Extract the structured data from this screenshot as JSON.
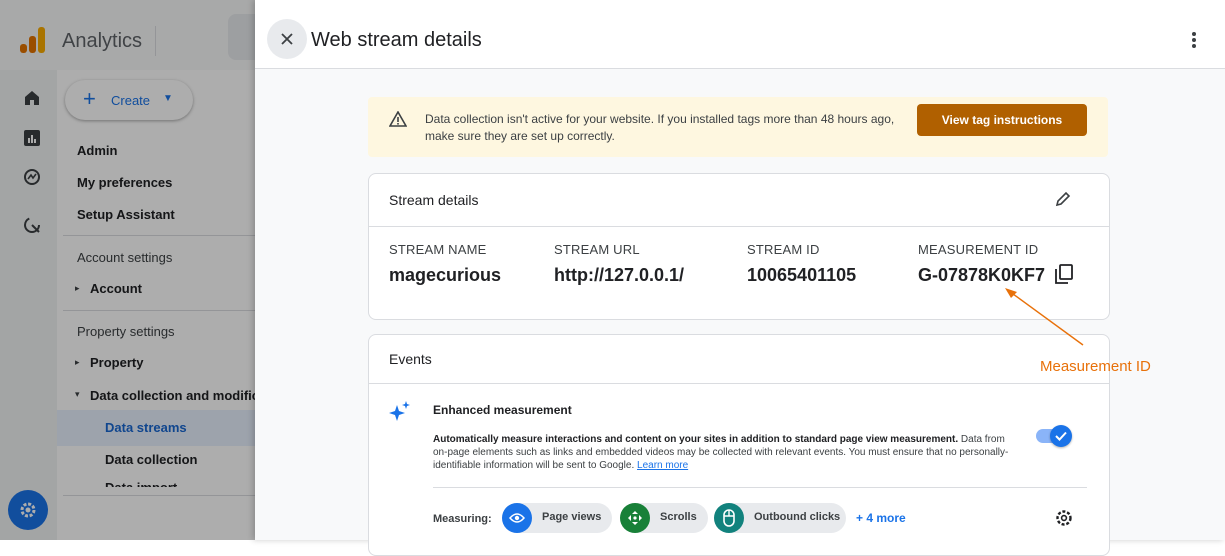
{
  "app": {
    "name": "Analytics"
  },
  "nav": {
    "create_label": "Create",
    "items": [
      "Admin",
      "My preferences",
      "Setup Assistant"
    ],
    "account_settings_label": "Account settings",
    "account_item": "Account",
    "property_settings_label": "Property settings",
    "property_item": "Property",
    "data_collection_item": "Data collection and modification",
    "data_streams_item": "Data streams",
    "data_collection_sub": "Data collection",
    "data_import_partial": "Data import"
  },
  "drawer": {
    "title": "Web stream details",
    "warning": {
      "text": "Data collection isn't active for your website. If you installed tags more than 48 hours ago, make sure they are set up correctly.",
      "button": "View tag instructions"
    },
    "stream_details": {
      "title": "Stream details",
      "fields": [
        {
          "label": "STREAM NAME",
          "value": "magecurious"
        },
        {
          "label": "STREAM URL",
          "value": "http://127.0.0.1/"
        },
        {
          "label": "STREAM ID",
          "value": "10065401105"
        },
        {
          "label": "MEASUREMENT ID",
          "value": "G-07878K0KF7"
        }
      ]
    },
    "events": {
      "title": "Events",
      "enhanced_title": "Enhanced measurement",
      "enhanced_desc_bold": "Automatically measure interactions and content on your sites in addition to standard page view measurement.",
      "enhanced_desc": "Data from on-page elements such as links and embedded videos may be collected with relevant events. You must ensure that no personally-identifiable information will be sent to Google.",
      "learn_more": "Learn more",
      "toggle_on": true,
      "measuring_label": "Measuring:",
      "chips": [
        "Page views",
        "Scrolls",
        "Outbound clicks"
      ],
      "more_link": "+ 4 more"
    }
  },
  "annotation": {
    "text": "Measurement ID",
    "color": "#e8710a"
  },
  "colors": {
    "accent": "#1a73e8",
    "warning_bg": "#fef7e0",
    "warning_button": "#b06000"
  }
}
